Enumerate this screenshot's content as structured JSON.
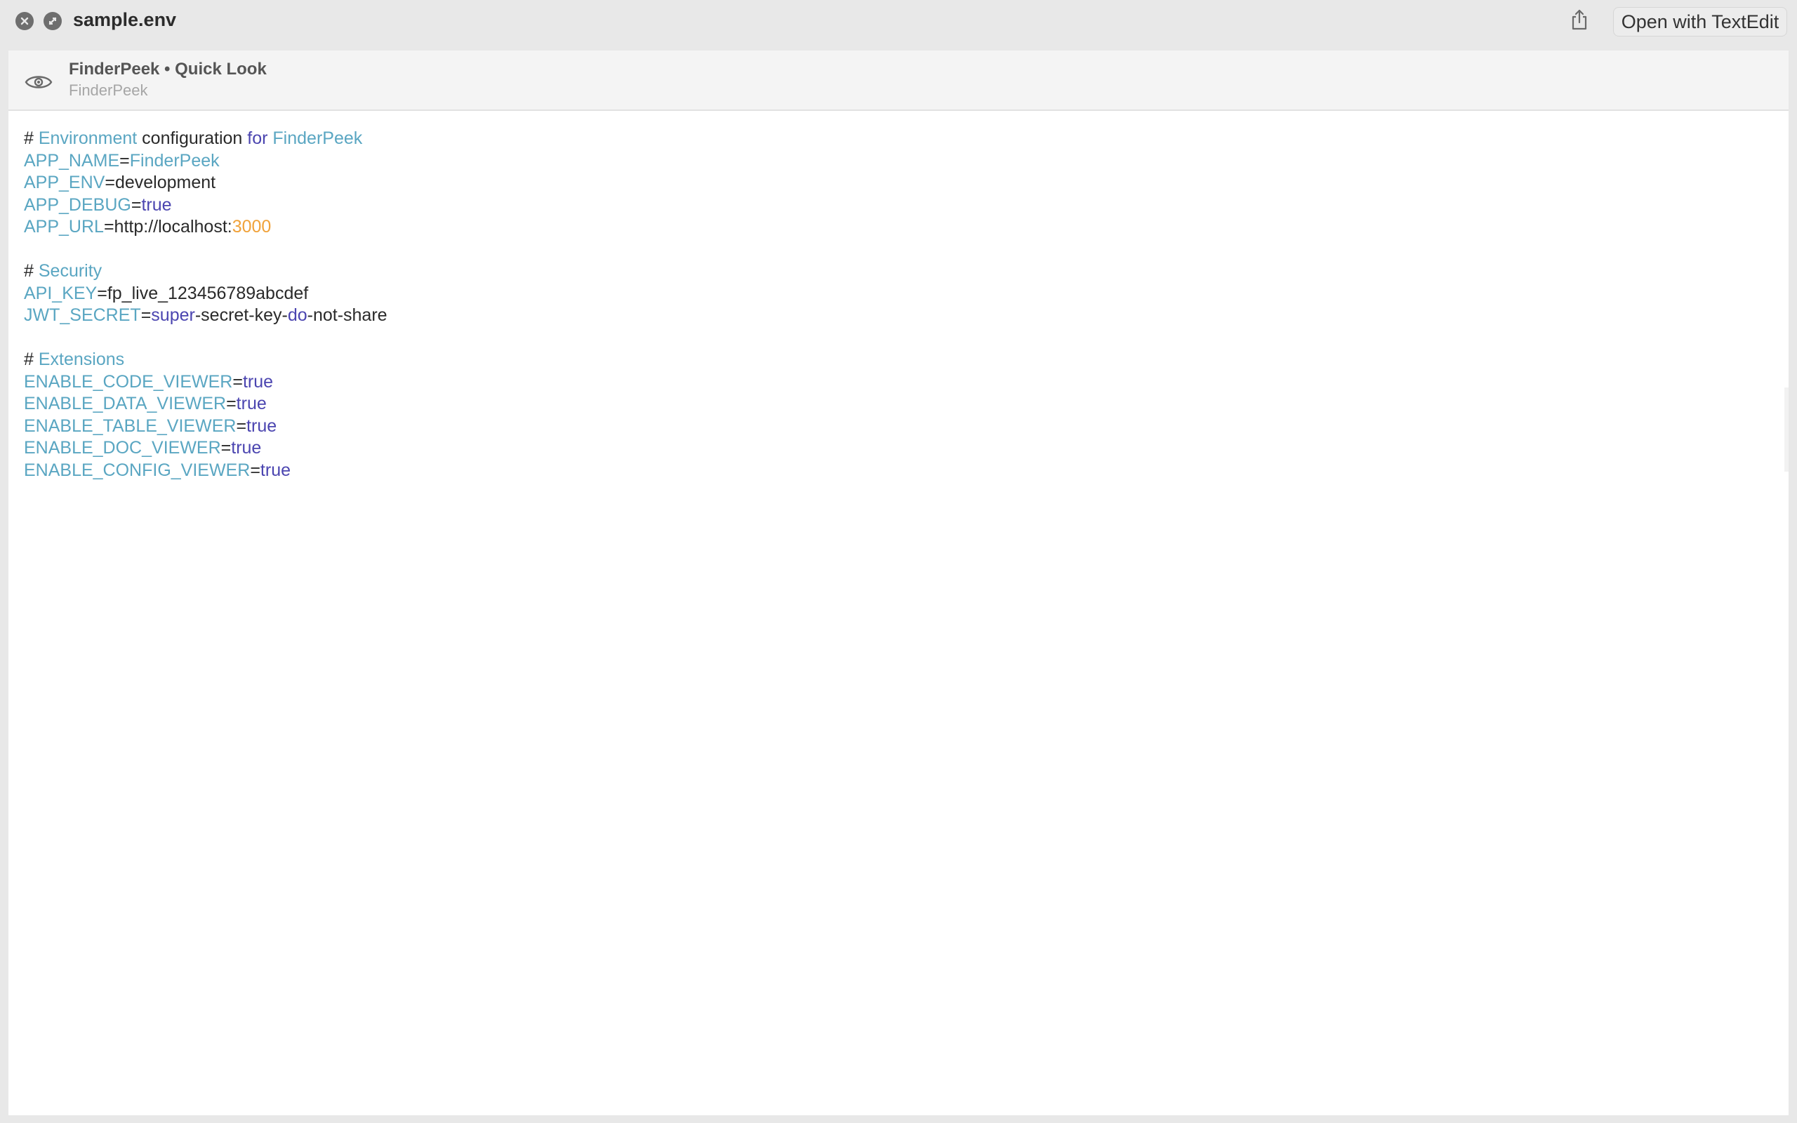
{
  "window": {
    "title": "sample.env",
    "open_with_label": "Open with TextEdit"
  },
  "header": {
    "title": "FinderPeek • Quick Look",
    "subtitle": "FinderPeek"
  },
  "colors": {
    "key": "#5aa6c2",
    "keyword": "#4b45b0",
    "number": "#f0a23a",
    "plain": "#2a2a2a"
  },
  "icons": {
    "close": "close-icon",
    "fullscreen": "fullscreen-icon",
    "share": "share-icon",
    "eye": "eye-icon"
  },
  "code_lines": [
    [
      [
        "plain",
        "# "
      ],
      [
        "key",
        "Environment"
      ],
      [
        "plain",
        " configuration "
      ],
      [
        "kw",
        "for"
      ],
      [
        "plain",
        " "
      ],
      [
        "key",
        "FinderPeek"
      ]
    ],
    [
      [
        "key",
        "APP_NAME"
      ],
      [
        "plain",
        "="
      ],
      [
        "key",
        "FinderPeek"
      ]
    ],
    [
      [
        "key",
        "APP_ENV"
      ],
      [
        "plain",
        "=development"
      ]
    ],
    [
      [
        "key",
        "APP_DEBUG"
      ],
      [
        "plain",
        "="
      ],
      [
        "kw",
        "true"
      ]
    ],
    [
      [
        "key",
        "APP_URL"
      ],
      [
        "plain",
        "=http://localhost:"
      ],
      [
        "num",
        "3000"
      ]
    ],
    [],
    [
      [
        "plain",
        "# "
      ],
      [
        "key",
        "Security"
      ]
    ],
    [
      [
        "key",
        "API_KEY"
      ],
      [
        "plain",
        "=fp_live_123456789abcdef"
      ]
    ],
    [
      [
        "key",
        "JWT_SECRET"
      ],
      [
        "plain",
        "="
      ],
      [
        "kw",
        "super"
      ],
      [
        "plain",
        "-secret-key-"
      ],
      [
        "kw",
        "do"
      ],
      [
        "plain",
        "-not-share"
      ]
    ],
    [],
    [
      [
        "plain",
        "# "
      ],
      [
        "key",
        "Extensions"
      ]
    ],
    [
      [
        "key",
        "ENABLE_CODE_VIEWER"
      ],
      [
        "plain",
        "="
      ],
      [
        "kw",
        "true"
      ]
    ],
    [
      [
        "key",
        "ENABLE_DATA_VIEWER"
      ],
      [
        "plain",
        "="
      ],
      [
        "kw",
        "true"
      ]
    ],
    [
      [
        "key",
        "ENABLE_TABLE_VIEWER"
      ],
      [
        "plain",
        "="
      ],
      [
        "kw",
        "true"
      ]
    ],
    [
      [
        "key",
        "ENABLE_DOC_VIEWER"
      ],
      [
        "plain",
        "="
      ],
      [
        "kw",
        "true"
      ]
    ],
    [
      [
        "key",
        "ENABLE_CONFIG_VIEWER"
      ],
      [
        "plain",
        "="
      ],
      [
        "kw",
        "true"
      ]
    ]
  ]
}
